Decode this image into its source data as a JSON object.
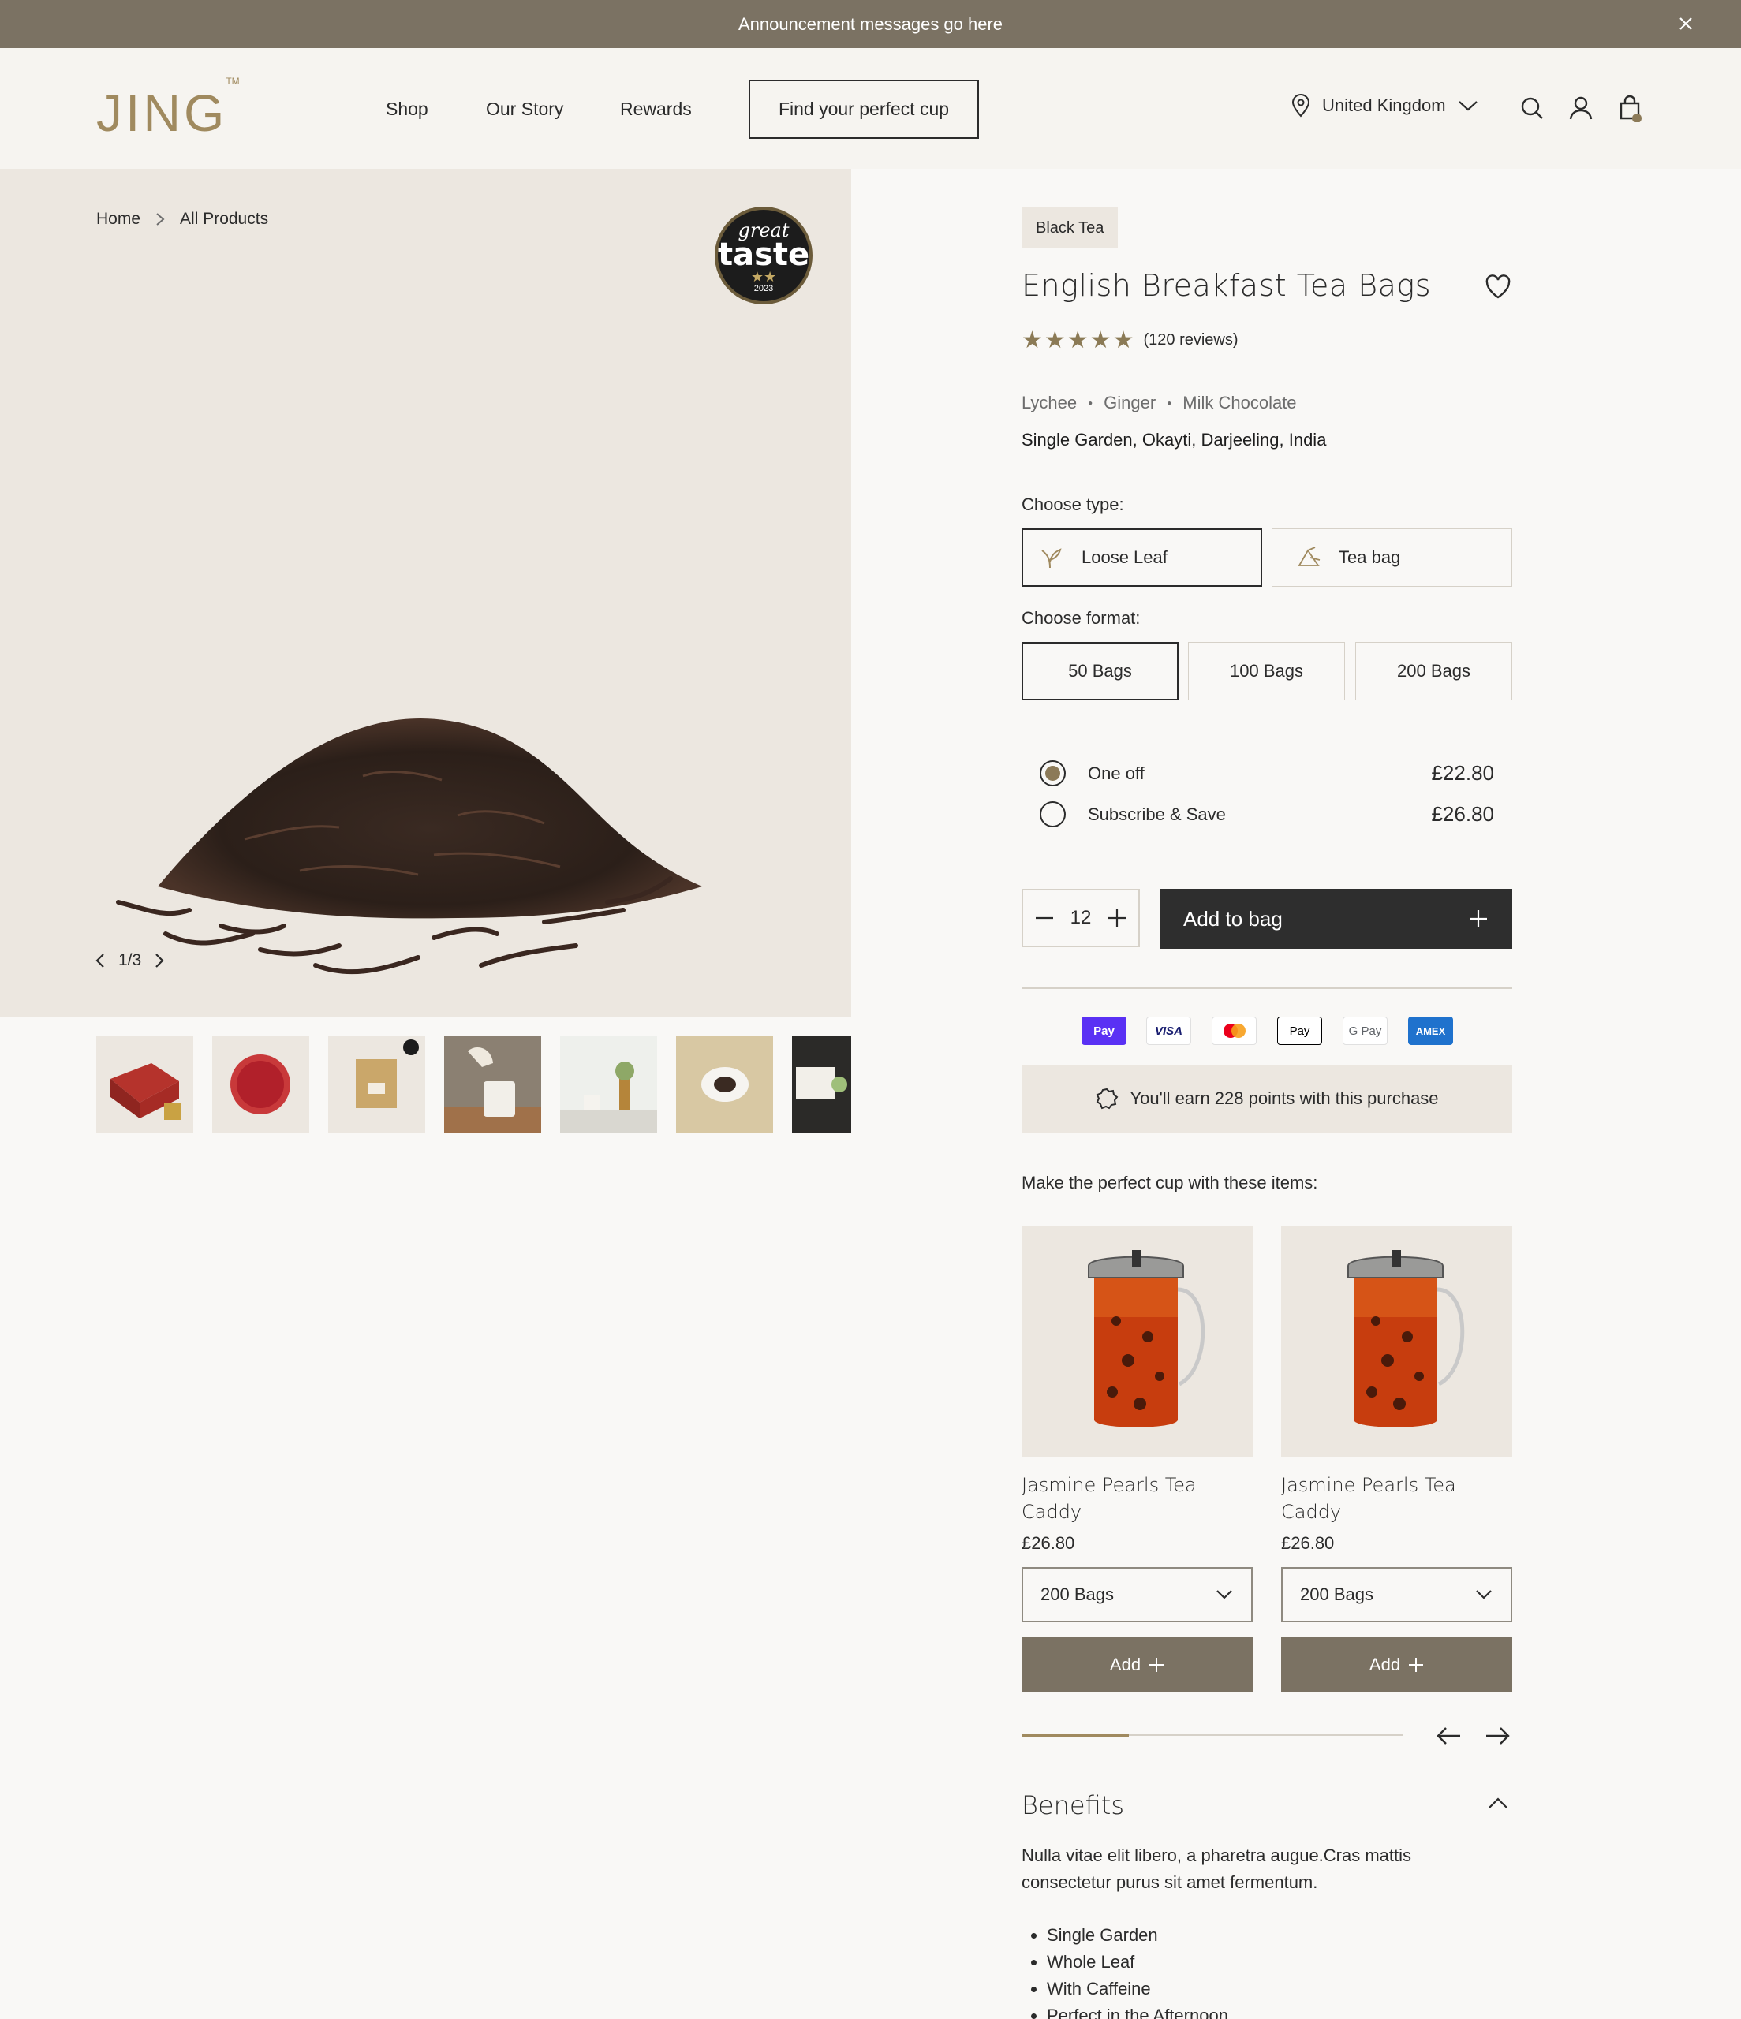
{
  "announcement": {
    "text": "Announcement messages go here"
  },
  "header": {
    "logo": "JING",
    "logo_tm": "TM",
    "nav": [
      "Shop",
      "Our Story",
      "Rewards"
    ],
    "cta": "Find your perfect cup",
    "country": "United Kingdom"
  },
  "gallery": {
    "breadcrumbs": [
      "Home",
      "All Products"
    ],
    "badge": {
      "line1": "great",
      "line2": "taste",
      "stars": "★★",
      "year": "2023"
    },
    "pager": "1/3",
    "thumbnail_count": 7
  },
  "product": {
    "category": "Black Tea",
    "title": "English Breakfast Tea Bags",
    "rating": 5,
    "stars": "★★★★★",
    "reviews": "(120 reviews)",
    "notes": [
      "Lychee",
      "Ginger",
      "Milk Chocolate"
    ],
    "origin": "Single Garden, Okayti, Darjeeling, India",
    "type_label": "Choose type:",
    "types": [
      {
        "label": "Loose Leaf",
        "icon": "leaf-icon",
        "selected": true
      },
      {
        "label": "Tea bag",
        "icon": "tea-bag-icon",
        "selected": false
      }
    ],
    "format_label": "Choose format:",
    "formats": [
      {
        "label": "50 Bags",
        "selected": true
      },
      {
        "label": "100 Bags",
        "selected": false
      },
      {
        "label": "200 Bags",
        "selected": false
      }
    ],
    "purchase_options": [
      {
        "label": "One off",
        "price": "£22.80",
        "selected": true
      },
      {
        "label": "Subscribe & Save",
        "price": "£26.80",
        "selected": false
      }
    ],
    "quantity": "12",
    "add_to_bag": "Add to bag",
    "payment_methods": [
      "G Pay",
      "VISA",
      "Mastercard",
      "Pay",
      "G Pay",
      "AMEX"
    ],
    "payment_labels": {
      "shop": "Pay",
      "visa": "VISA",
      "apple": "Pay",
      "google": "G Pay",
      "amex": "AMEX"
    },
    "points": "You'll earn 228 points with this purchase"
  },
  "recommendations": {
    "heading": "Make the perfect cup with these items:",
    "items": [
      {
        "name": "Jasmine Pearls Tea Caddy",
        "price": "£26.80",
        "format": "200 Bags",
        "add_label": "Add"
      },
      {
        "name": "Jasmine Pearls Tea Caddy",
        "price": "£26.80",
        "format": "200 Bags",
        "add_label": "Add"
      }
    ],
    "carousel_progress": 0.28
  },
  "benefits": {
    "heading": "Benefits",
    "text": "Nulla vitae elit libero, a pharetra augue.Cras mattis consectetur purus sit amet fermentum.",
    "list": [
      "Single Garden",
      "Whole Leaf",
      "With Caffeine",
      "Perfect in the Afternoon"
    ]
  },
  "colors": {
    "announcement_bg": "#7b7263",
    "accent": "#a08a5f",
    "dark_button": "#2e2e2e",
    "image_bg": "#ece7e0"
  }
}
